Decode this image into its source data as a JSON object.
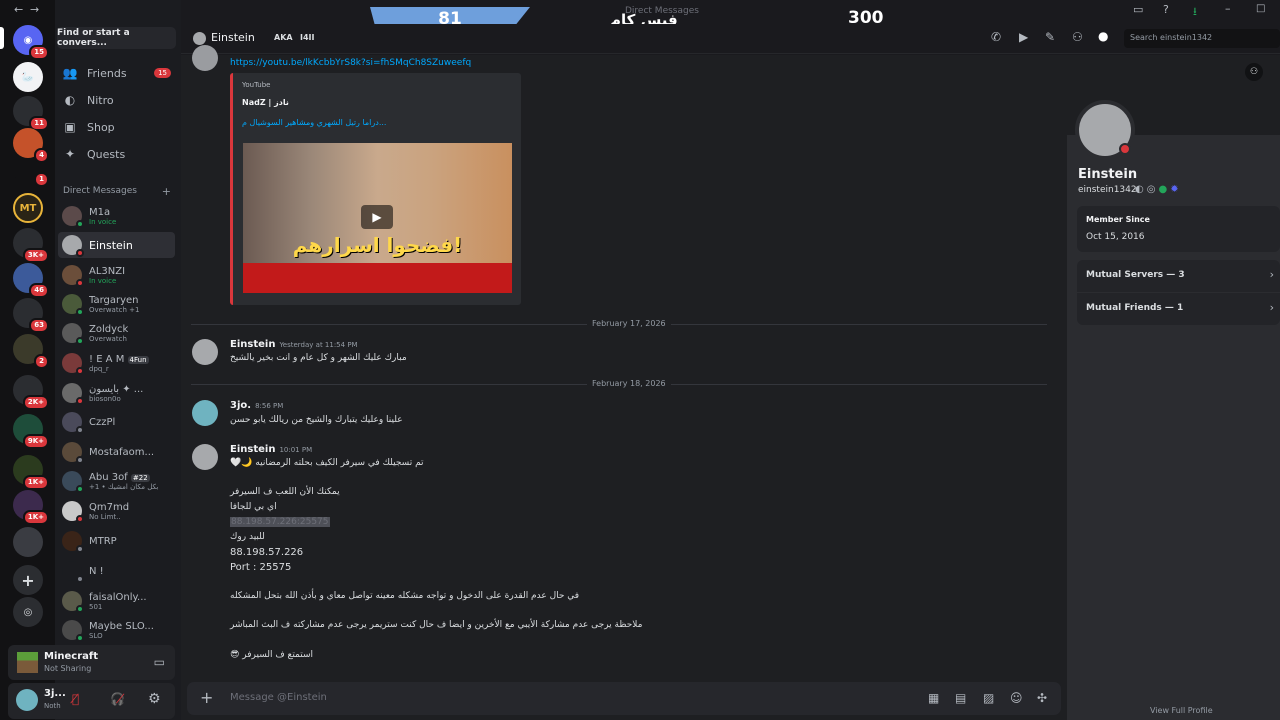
{
  "overlay": {
    "left_score": "81",
    "title": "فيس كام",
    "right_score": "300",
    "window_label": "Direct Messages"
  },
  "rail": {
    "badges": [
      "15",
      "11",
      "4",
      "1",
      "3K+",
      "46",
      "63",
      "2",
      "2K+",
      "9K+",
      "1K+",
      "1K+"
    ],
    "server_label": "MT"
  },
  "dm_panel": {
    "find_label": "Find or start a convers...",
    "nav": [
      {
        "label": "Friends",
        "icon": "friends-icon",
        "count": "15"
      },
      {
        "label": "Nitro",
        "icon": "nitro-icon"
      },
      {
        "label": "Shop",
        "icon": "shop-icon"
      },
      {
        "label": "Quests",
        "icon": "quests-icon"
      }
    ],
    "section_title": "Direct Messages",
    "items": [
      {
        "name": "M1a",
        "sub": "In voice",
        "status": "#23a55a"
      },
      {
        "name": "Einstein",
        "sub": "",
        "status": "#da373c"
      },
      {
        "name": "AL3NZI",
        "sub": "In voice",
        "status": "#da373c"
      },
      {
        "name": "Targaryen",
        "sub": "Overwatch +1",
        "status": "#23a55a"
      },
      {
        "name": "Zoldyck",
        "sub": "Overwatch",
        "status": "#23a55a"
      },
      {
        "name": "! E A M",
        "sub": "dpq_r",
        "status": "#da373c",
        "tag": "4Fun"
      },
      {
        "name": "بايسون ✦ ...",
        "sub": "bioson0o",
        "status": "#da373c"
      },
      {
        "name": "CzzPl",
        "sub": "",
        "status": "#80848e"
      },
      {
        "name": "Mostafaom...",
        "sub": "",
        "status": "#80848e"
      },
      {
        "name": "Abu 3of",
        "sub": "+1 • بكل مكان امشيك",
        "status": "#23a55a",
        "tag": "#22"
      },
      {
        "name": "Qm7md",
        "sub": "No Limt..",
        "status": "#da373c"
      },
      {
        "name": "MTRP",
        "sub": "",
        "status": "#80848e"
      },
      {
        "name": "N !",
        "sub": "",
        "status": "#80848e"
      },
      {
        "name": "faisalOnly...",
        "sub": "501",
        "status": "#23a55a"
      },
      {
        "name": "Maybe SLO...",
        "sub": "SLO",
        "status": "#23a55a"
      }
    ],
    "activity": {
      "title": "Minecraft",
      "sub": "Not Sharing"
    },
    "user": {
      "name": "3j...",
      "sub": "Noth"
    }
  },
  "topbar": {
    "name": "Einstein",
    "aka_label": "AKA",
    "aka_value": "I4II",
    "search_placeholder": "Search einstein1342"
  },
  "chat": {
    "link": "https://youtu.be/lkKcbbYrS8k?si=fhSMqCh8SZuweefq",
    "embed": {
      "provider": "YouTube",
      "author": "NadZ | نادز",
      "title": "دراما رتيل الشهري ومشاهير السوشيال م...",
      "thumb_text": "فضحوا اسرارهم!"
    },
    "dividers": [
      "February 17, 2026",
      "February 18, 2026"
    ],
    "messages": [
      {
        "author": "Einstein",
        "time": "Yesterday at 11:54 PM",
        "lines": [
          "مبارك عليك الشهر و كل عام و انت بخير يالشيخ"
        ]
      },
      {
        "author": "3jo.",
        "time": "8:56 PM",
        "lines": [
          "علينا وعليك يتبارك والشيخ من ريالك يابو حسن"
        ]
      },
      {
        "author": "Einstein",
        "time": "10:01 PM",
        "lines": [
          "🤍🌙 تم تسجيلك في سيرفر الكيف بحلته الرمضانيه",
          "يمكنك الأن اللعب ف السيرفر",
          "اي بي للجافا",
          "88.198.57.226:25575",
          "للبيد روك",
          "88.198.57.226",
          "Port : 25575",
          "في حال عدم القدرة على الدخول و تواجه مشكله معينه تواصل معاي و بأذن الله بتحل المشكله",
          "ملاحظة يرجى عدم مشاركة الأيبي مع الأخرين و ايضا ف حال كنت ستريمر يرجى عدم مشاركته ف البث المباشر",
          "😎 استمتع ف السيرفر"
        ]
      }
    ],
    "input_placeholder": "Message @Einstein"
  },
  "profile": {
    "display_name": "Einstein",
    "username": "einstein1342",
    "member_since_label": "Member Since",
    "member_since": "Oct 15, 2016",
    "mutual_servers": "Mutual Servers — 3",
    "mutual_friends": "Mutual Friends — 1",
    "view_full": "View Full Profile"
  }
}
